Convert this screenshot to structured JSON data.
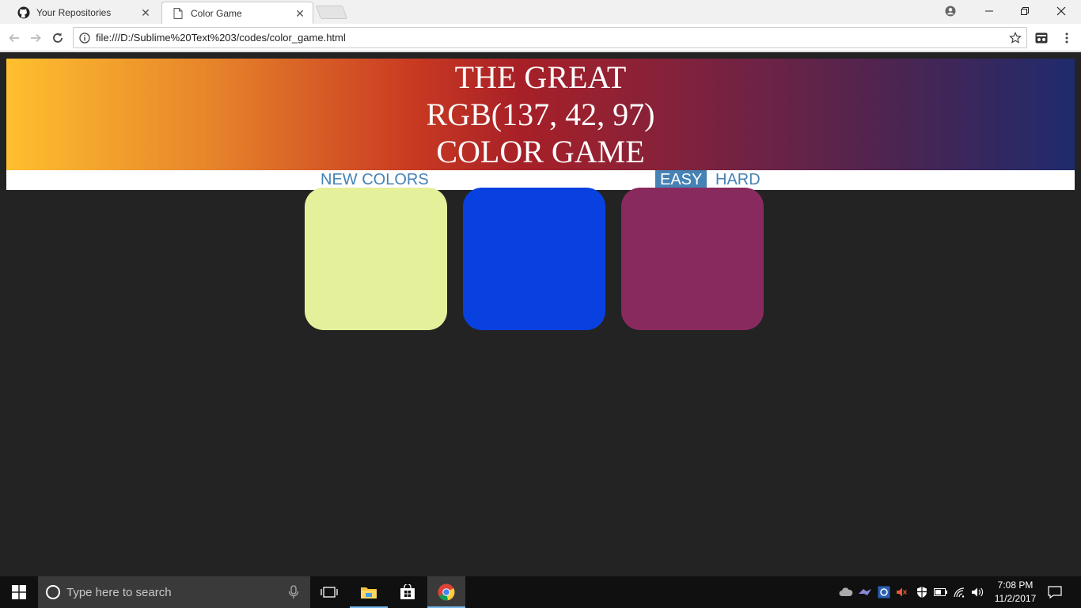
{
  "browser": {
    "tabs": [
      {
        "title": "Your Repositories",
        "icon": "github-icon",
        "active": false
      },
      {
        "title": "Color Game",
        "icon": "page-icon",
        "active": true
      }
    ],
    "url": "file:///D:/Sublime%20Text%203/codes/color_game.html"
  },
  "game": {
    "title_line1": "THE GREAT",
    "target_color": "RGB(137, 42, 97)",
    "title_line3": "COLOR GAME",
    "new_colors_label": "NEW COLORS",
    "easy_label": "EASY",
    "hard_label": "HARD",
    "selected_mode": "EASY",
    "squares": [
      {
        "color": "#e4f09a"
      },
      {
        "color": "#0941e0"
      },
      {
        "color": "#892a5f"
      }
    ],
    "accent_color": "#4682b4",
    "background_color": "#232323"
  },
  "taskbar": {
    "search_placeholder": "Type here to search",
    "time": "7:08 PM",
    "date": "11/2/2017"
  }
}
